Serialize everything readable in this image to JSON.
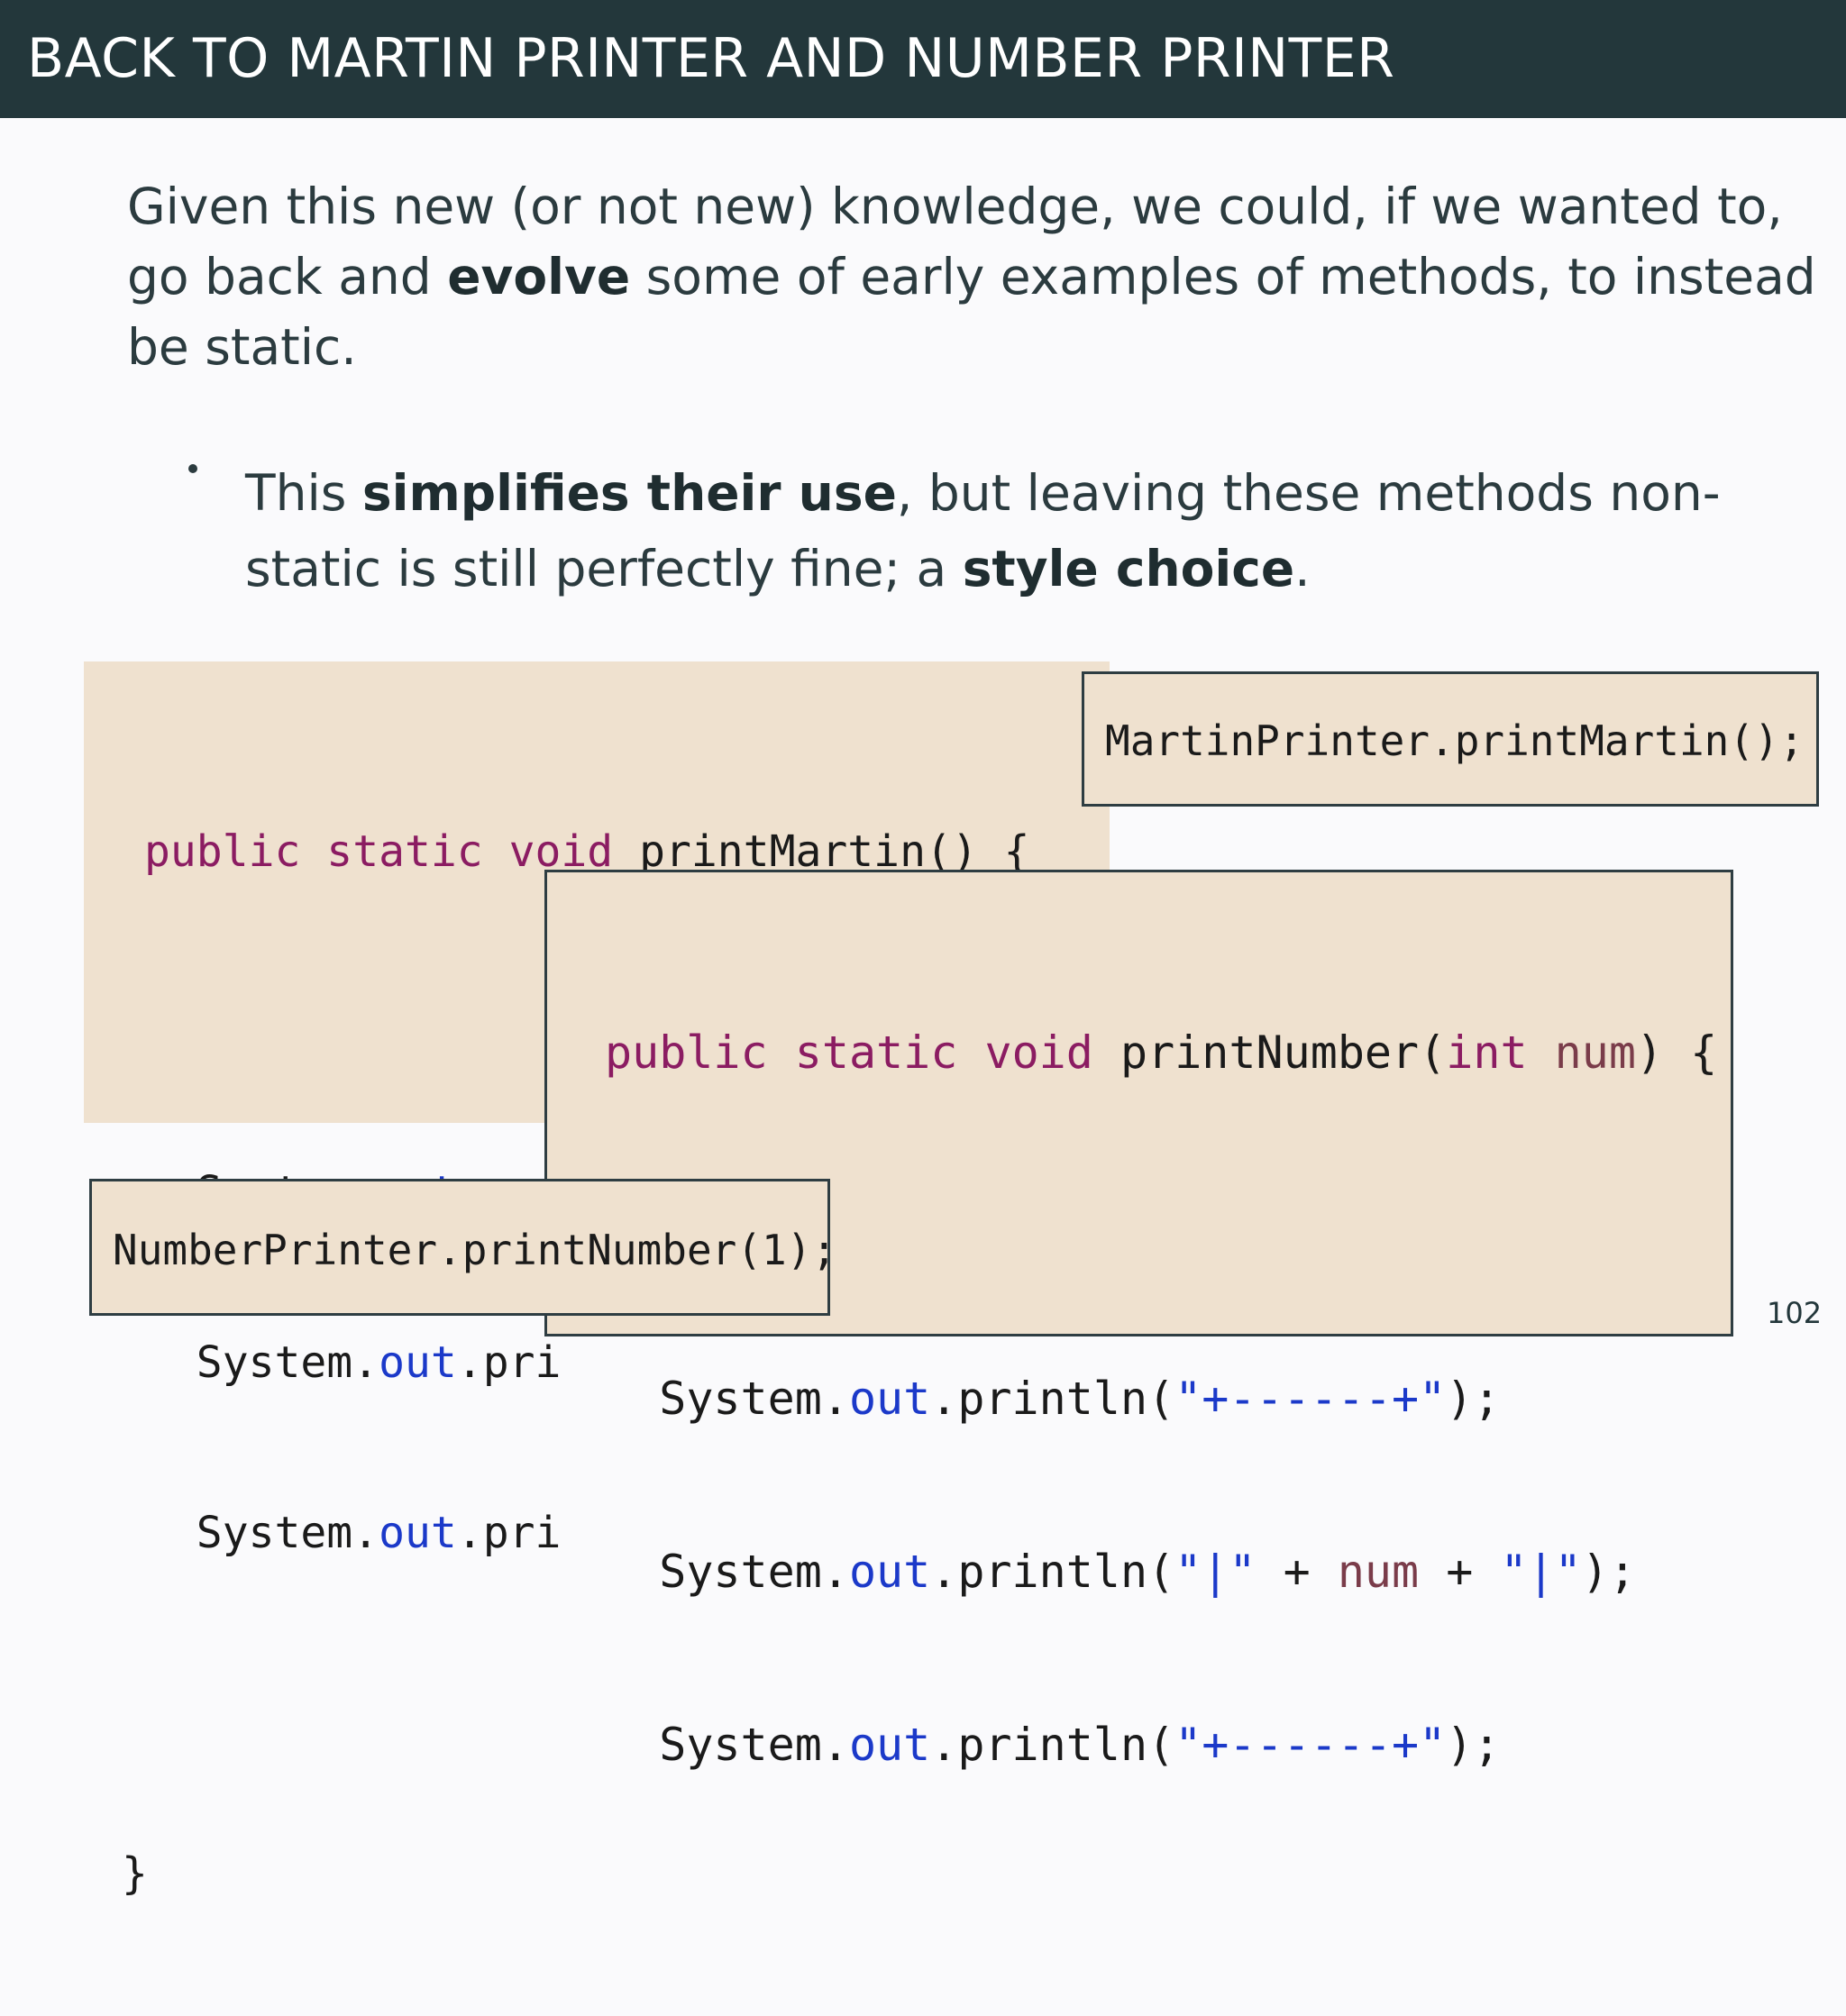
{
  "header": {
    "title": "BACK TO MARTIN PRINTER AND NUMBER PRINTER"
  },
  "intro": {
    "line1": "Given this new (or not new) knowledge, we could, if we wanted to,",
    "line2_pre": "go back and ",
    "line2_bold": "evolve",
    "line2_post": " some of early examples of methods, to instead",
    "line3": "be static."
  },
  "bullet": {
    "line1_pre": "This ",
    "line1_bold": "simplifies their use",
    "line1_post": ", but leaving these methods non-",
    "line2_pre": "static is still perfectly fine; a ",
    "line2_bold": "style choice",
    "line2_post": "."
  },
  "code_martin": {
    "kw_public": "public",
    "kw_static": "static",
    "kw_void": "void",
    "signature": " printMartin() {",
    "sys": "System.",
    "out": "out",
    "call_prefix": ".println(",
    "str_border": "\"+------+\"",
    "call_suffix": ");",
    "cut_call": ".pri",
    "close": "}"
  },
  "code_call_martin": {
    "text": "MartinPrinter.printMartin();"
  },
  "code_number": {
    "kw_public": "public",
    "kw_static": "static",
    "kw_void": "void",
    "method_name": " printNumber(",
    "kw_int": "int",
    "param": "num",
    "signature_end": ") {",
    "sys": "System.",
    "out": "out",
    "call_prefix": ".println(",
    "str_border": "\"+------+\"",
    "str_pipe": "\"|\"",
    "plus": " + ",
    "var_num": "num",
    "call_suffix": ");"
  },
  "code_call_number": {
    "text": "NumberPrinter.printNumber(1);"
  },
  "page_number": "102"
}
